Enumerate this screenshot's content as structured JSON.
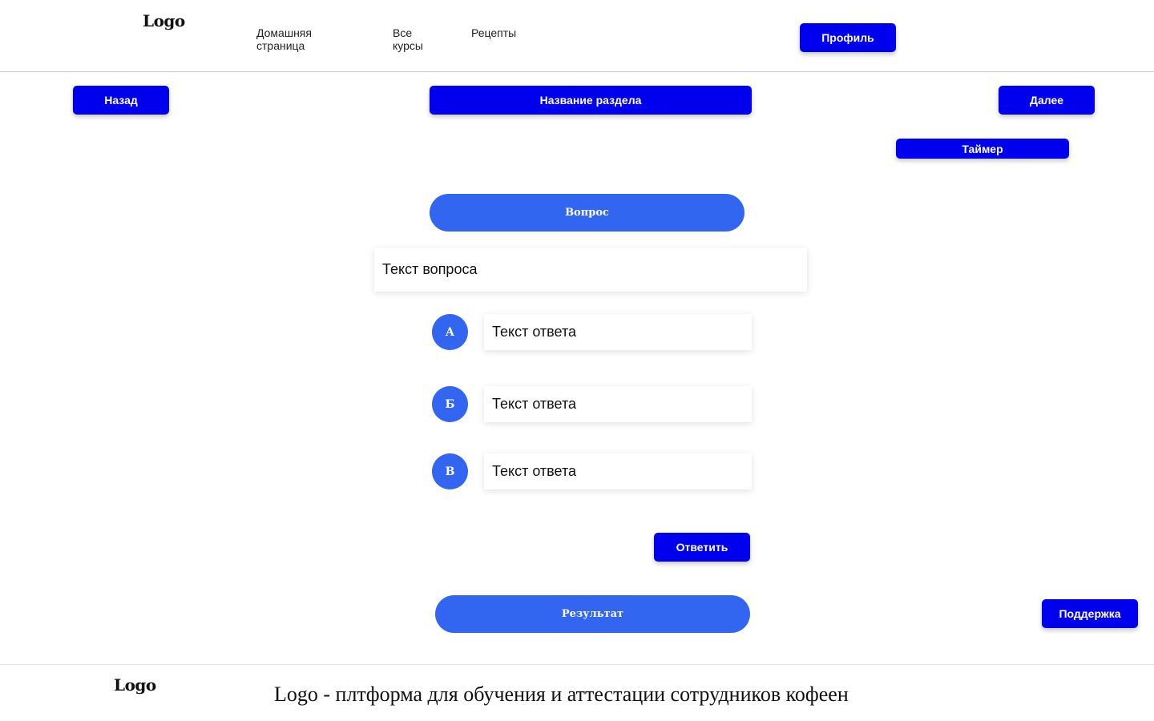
{
  "header": {
    "logo": "Logo",
    "nav": {
      "home": "Домашняя страница",
      "courses": "Все курсы",
      "recipes": "Рецепты"
    },
    "profile_button": "Профиль"
  },
  "navigation": {
    "back_button": "Назад",
    "section_title": "Название раздела",
    "next_button": "Далее",
    "timer_button": "Таймер"
  },
  "quiz": {
    "question_label": "Вопрос",
    "question_text": "Текст вопроса",
    "answers": [
      {
        "letter": "А",
        "text": "Текст ответа"
      },
      {
        "letter": "Б",
        "text": "Текст ответа"
      },
      {
        "letter": "В",
        "text": "Текст ответа"
      }
    ],
    "answer_button": "Ответить",
    "result_label": "Результат"
  },
  "support_button": "Поддержка",
  "footer": {
    "logo": "Logo",
    "tagline": "Logo - плтформа для обучения и аттестации сотрудников  кофеен"
  },
  "colors": {
    "primary_button": "#0000ee",
    "accent_blue": "#3366f0",
    "background": "#ffffff"
  }
}
